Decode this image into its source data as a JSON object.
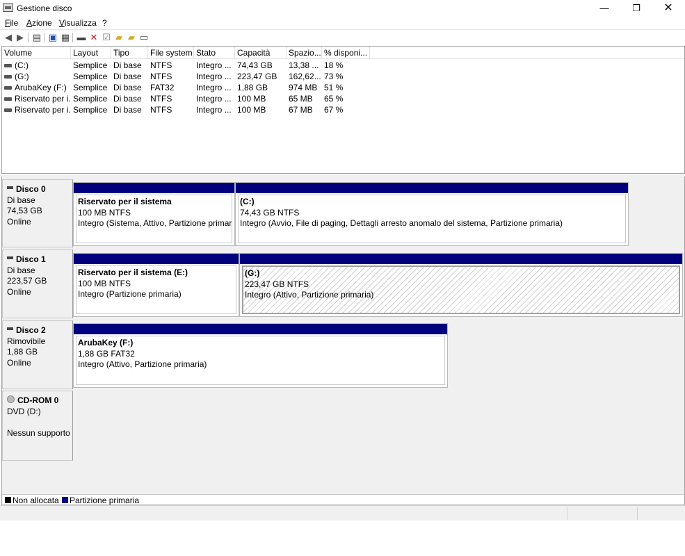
{
  "window": {
    "title": "Gestione disco",
    "minimize": "—",
    "restore": "❐",
    "close": "✕"
  },
  "menu": [
    "File",
    "Azione",
    "Visualizza",
    "?"
  ],
  "toolbar_icons": [
    "back-icon",
    "forward-icon",
    "show-hide-console-tree-icon",
    "properties-icon",
    "help-icon",
    "list-icon",
    "connect-disk-icon",
    "delete-icon",
    "check-icon",
    "folder-up-icon",
    "folder-export-icon",
    "view-icon"
  ],
  "volume_list": {
    "columns": [
      "Volume",
      "Layout",
      "Tipo",
      "File system",
      "Stato",
      "Capacità",
      "Spazio...",
      "% disponi..."
    ],
    "rows": [
      [
        "(C:)",
        "Semplice",
        "Di base",
        "NTFS",
        "Integro ...",
        "74,43 GB",
        "13,38 ...",
        "18 %"
      ],
      [
        "(G:)",
        "Semplice",
        "Di base",
        "NTFS",
        "Integro ...",
        "223,47 GB",
        "162,62...",
        "73 %"
      ],
      [
        "ArubaKey (F:)",
        "Semplice",
        "Di base",
        "FAT32",
        "Integro ...",
        "1,88 GB",
        "974 MB",
        "51 %"
      ],
      [
        "Riservato per i...",
        "Semplice",
        "Di base",
        "NTFS",
        "Integro ...",
        "100 MB",
        "65 MB",
        "65 %"
      ],
      [
        "Riservato per i...",
        "Semplice",
        "Di base",
        "NTFS",
        "Integro ...",
        "100 MB",
        "67 MB",
        "67 %"
      ]
    ]
  },
  "disks": [
    {
      "name": "Disco 0",
      "type": "Di base",
      "size": "74,53 GB",
      "status": "Online",
      "partitions": [
        {
          "title": "Riservato per il sistema",
          "size": "100 MB NTFS",
          "status": "Integro (Sistema, Attivo, Partizione primaria"
        },
        {
          "title": " (C:)",
          "size": "74,43 GB NTFS",
          "status": "Integro (Avvio, File di paging, Dettagli arresto anomalo del sistema, Partizione primaria)"
        }
      ]
    },
    {
      "name": "Disco 1",
      "type": "Di base",
      "size": "223,57 GB",
      "status": "Online",
      "partitions": [
        {
          "title": "Riservato per il sistema  (E:)",
          "size": "100 MB NTFS",
          "status": "Integro (Partizione primaria)"
        },
        {
          "title": " (G:)",
          "size": "223,47 GB NTFS",
          "status": "Integro (Attivo, Partizione primaria)"
        }
      ]
    },
    {
      "name": "Disco 2",
      "type": "Rimovibile",
      "size": "1,88 GB",
      "status": "Online",
      "partitions": [
        {
          "title": "ArubaKey  (F:)",
          "size": "1,88 GB FAT32",
          "status": "Integro (Attivo, Partizione primaria)"
        }
      ]
    },
    {
      "name": "CD-ROM 0",
      "type": "DVD (D:)",
      "size": "",
      "status": "Nessun supporto"
    }
  ],
  "legend": [
    {
      "label": "Non allocata",
      "color": "#000000"
    },
    {
      "label": "Partizione primaria",
      "color": "#00007e"
    }
  ]
}
